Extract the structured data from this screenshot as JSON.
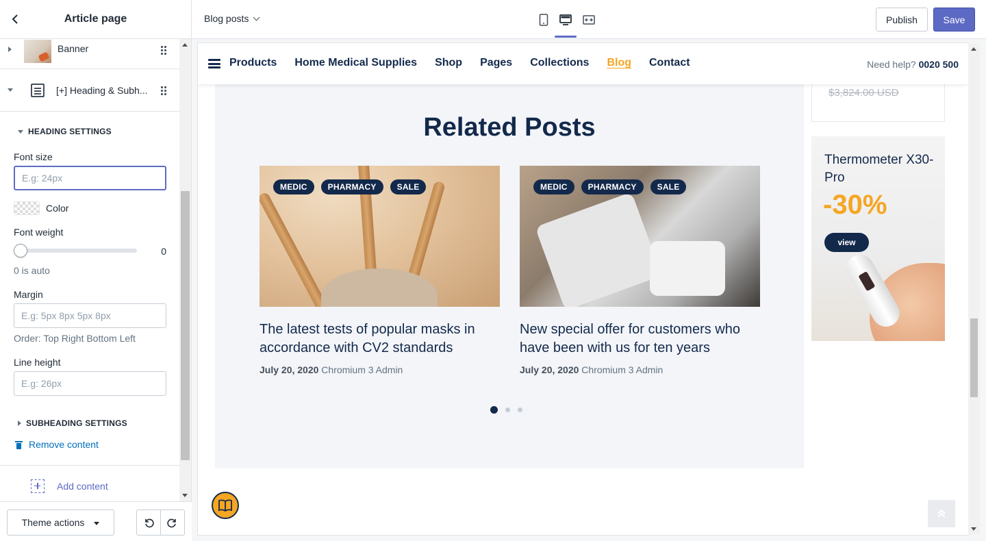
{
  "editor": {
    "title": "Article page",
    "sections": [
      {
        "label": "Banner"
      },
      {
        "label": "[+] Heading & Subh..."
      }
    ],
    "heading_settings": {
      "label": "HEADING SETTINGS",
      "font_size": {
        "label": "Font size",
        "placeholder": "E.g: 24px",
        "value": ""
      },
      "color": {
        "label": "Color"
      },
      "font_weight": {
        "label": "Font weight",
        "value": "0",
        "hint": "0 is auto"
      },
      "margin": {
        "label": "Margin",
        "placeholder": "E.g: 5px 8px 5px 8px",
        "hint": "Order: Top Right Bottom Left"
      },
      "line_height": {
        "label": "Line height",
        "placeholder": "E.g: 26px"
      }
    },
    "subheading_settings": {
      "label": "SUBHEADING SETTINGS"
    },
    "remove_label": "Remove content",
    "add_label": "Add content",
    "theme_actions_label": "Theme actions"
  },
  "topbar": {
    "page_select": "Blog posts",
    "publish_label": "Publish",
    "save_label": "Save",
    "accent": "#5c6ac4"
  },
  "site": {
    "nav": [
      "Products",
      "Home Medical Supplies",
      "Shop",
      "Pages",
      "Collections",
      "Blog",
      "Contact"
    ],
    "active_nav": "Blog",
    "help_text": "Need help?",
    "help_phone": "0020 500",
    "related": {
      "title": "Related Posts",
      "posts": [
        {
          "tags": [
            "MEDIC",
            "PHARMACY",
            "SALE"
          ],
          "title": "The latest tests of popular masks in accordance with CV2 standards",
          "date": "July 20, 2020",
          "author": "Chromium 3 Admin"
        },
        {
          "tags": [
            "MEDIC",
            "PHARMACY",
            "SALE"
          ],
          "title": "New special offer for customers who have been with us for ten years",
          "date": "July 20, 2020",
          "author": "Chromium 3 Admin"
        }
      ]
    },
    "sidebar": {
      "old_price": "$3,824.00 USD",
      "promo_title": "Thermometer X30-Pro",
      "promo_discount": "-30%",
      "promo_button": "view"
    },
    "colors": {
      "navy": "#13294b",
      "orange": "#f5a623"
    }
  }
}
